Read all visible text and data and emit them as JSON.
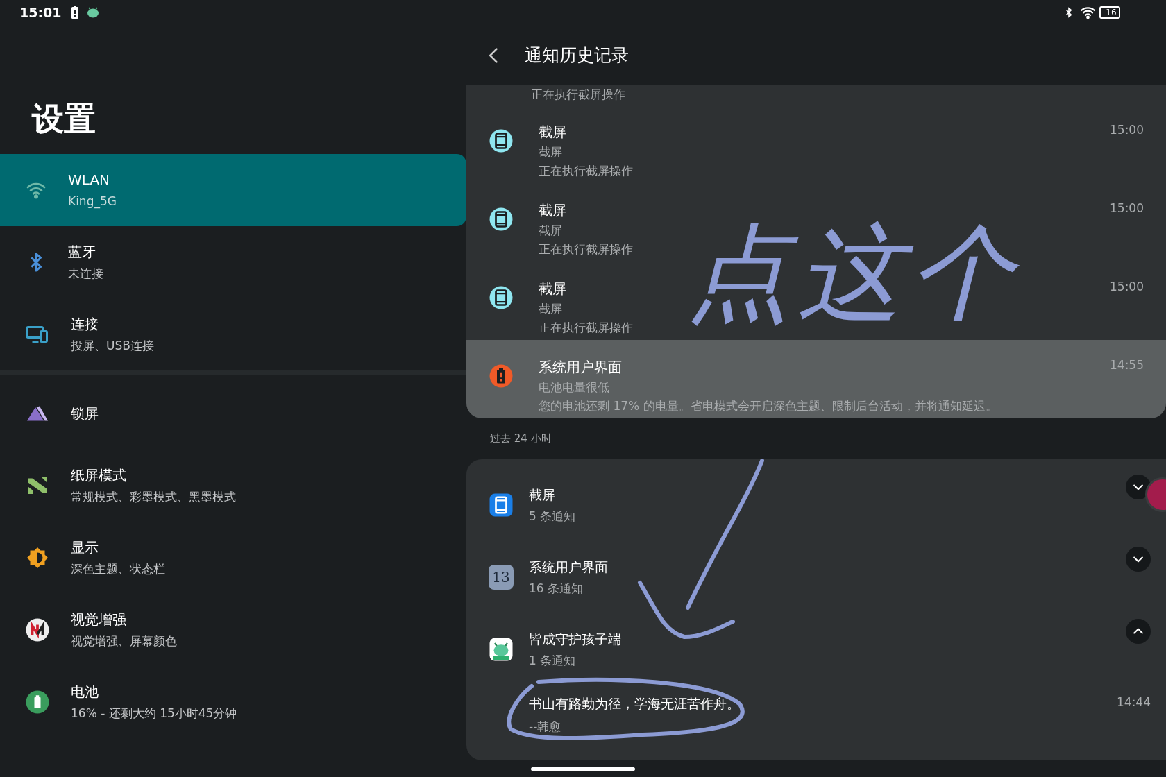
{
  "status_bar": {
    "time": "15:01",
    "battery_text": "16"
  },
  "settings": {
    "title": "设置",
    "groups": [
      [
        {
          "title": "WLAN",
          "subtitle": "King_5G",
          "selected": true
        },
        {
          "title": "蓝牙",
          "subtitle": "未连接",
          "selected": false
        },
        {
          "title": "连接",
          "subtitle": "投屏、USB连接",
          "selected": false
        }
      ],
      [
        {
          "title": "锁屏",
          "selected": false
        },
        {
          "title": "纸屏模式",
          "subtitle": "常规模式、彩墨模式、黑墨模式",
          "selected": false
        },
        {
          "title": "显示",
          "subtitle": "深色主题、状态栏",
          "selected": false
        },
        {
          "title": "视觉增强",
          "subtitle": "视觉增强、屏幕颜色",
          "selected": false
        },
        {
          "title": "电池",
          "subtitle": "16% - 还剩大约 15小时45分钟",
          "selected": false
        }
      ]
    ]
  },
  "history": {
    "title": "通知历史记录",
    "partial_text": "正在执行截屏操作",
    "recent_items": [
      {
        "kind": "screenshot",
        "title": "截屏",
        "app": "截屏",
        "text": "正在执行截屏操作",
        "time": "15:00",
        "highlighted": false
      },
      {
        "kind": "screenshot",
        "title": "截屏",
        "app": "截屏",
        "text": "正在执行截屏操作",
        "time": "15:00",
        "highlighted": false
      },
      {
        "kind": "screenshot",
        "title": "截屏",
        "app": "截屏",
        "text": "正在执行截屏操作",
        "time": "15:00",
        "highlighted": false
      },
      {
        "kind": "battery",
        "title": "系统用户界面",
        "app": "电池电量很低",
        "text": "您的电池还剩 17% 的电量。省电模式会开启深色主题、限制后台活动，并将通知延迟。",
        "time": "14:55",
        "highlighted": true
      }
    ],
    "section_label": "过去 24 小时",
    "apps": [
      {
        "kind": "screenshot",
        "name": "截屏",
        "count": "5 条通知",
        "expanded": false
      },
      {
        "kind": "system",
        "name": "系统用户界面",
        "icon_text": "13",
        "count": "16 条通知",
        "expanded": false
      },
      {
        "kind": "guardian",
        "name": "皆成守护孩子端",
        "count": "1 条通知",
        "expanded": true,
        "children": [
          {
            "text": "书山有路勤为径，学海无涯苦作舟。",
            "author": "--韩愈",
            "time": "14:44"
          }
        ]
      }
    ]
  },
  "annotation": {
    "handwriting": "点这个"
  }
}
